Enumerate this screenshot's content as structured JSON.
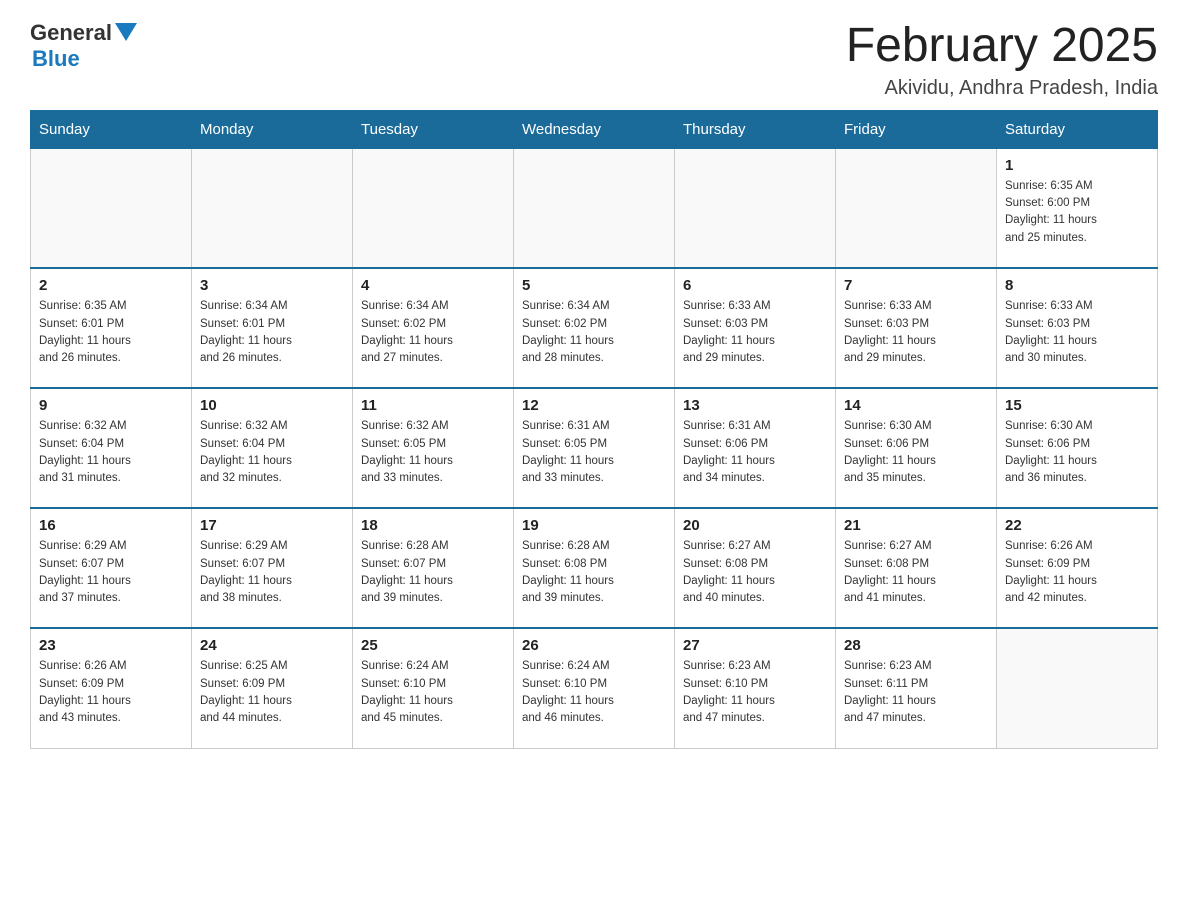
{
  "logo": {
    "line1": "General",
    "line2": "Blue"
  },
  "title": "February 2025",
  "subtitle": "Akividu, Andhra Pradesh, India",
  "days_of_week": [
    "Sunday",
    "Monday",
    "Tuesday",
    "Wednesday",
    "Thursday",
    "Friday",
    "Saturday"
  ],
  "weeks": [
    [
      {
        "day": "",
        "info": ""
      },
      {
        "day": "",
        "info": ""
      },
      {
        "day": "",
        "info": ""
      },
      {
        "day": "",
        "info": ""
      },
      {
        "day": "",
        "info": ""
      },
      {
        "day": "",
        "info": ""
      },
      {
        "day": "1",
        "info": "Sunrise: 6:35 AM\nSunset: 6:00 PM\nDaylight: 11 hours\nand 25 minutes."
      }
    ],
    [
      {
        "day": "2",
        "info": "Sunrise: 6:35 AM\nSunset: 6:01 PM\nDaylight: 11 hours\nand 26 minutes."
      },
      {
        "day": "3",
        "info": "Sunrise: 6:34 AM\nSunset: 6:01 PM\nDaylight: 11 hours\nand 26 minutes."
      },
      {
        "day": "4",
        "info": "Sunrise: 6:34 AM\nSunset: 6:02 PM\nDaylight: 11 hours\nand 27 minutes."
      },
      {
        "day": "5",
        "info": "Sunrise: 6:34 AM\nSunset: 6:02 PM\nDaylight: 11 hours\nand 28 minutes."
      },
      {
        "day": "6",
        "info": "Sunrise: 6:33 AM\nSunset: 6:03 PM\nDaylight: 11 hours\nand 29 minutes."
      },
      {
        "day": "7",
        "info": "Sunrise: 6:33 AM\nSunset: 6:03 PM\nDaylight: 11 hours\nand 29 minutes."
      },
      {
        "day": "8",
        "info": "Sunrise: 6:33 AM\nSunset: 6:03 PM\nDaylight: 11 hours\nand 30 minutes."
      }
    ],
    [
      {
        "day": "9",
        "info": "Sunrise: 6:32 AM\nSunset: 6:04 PM\nDaylight: 11 hours\nand 31 minutes."
      },
      {
        "day": "10",
        "info": "Sunrise: 6:32 AM\nSunset: 6:04 PM\nDaylight: 11 hours\nand 32 minutes."
      },
      {
        "day": "11",
        "info": "Sunrise: 6:32 AM\nSunset: 6:05 PM\nDaylight: 11 hours\nand 33 minutes."
      },
      {
        "day": "12",
        "info": "Sunrise: 6:31 AM\nSunset: 6:05 PM\nDaylight: 11 hours\nand 33 minutes."
      },
      {
        "day": "13",
        "info": "Sunrise: 6:31 AM\nSunset: 6:06 PM\nDaylight: 11 hours\nand 34 minutes."
      },
      {
        "day": "14",
        "info": "Sunrise: 6:30 AM\nSunset: 6:06 PM\nDaylight: 11 hours\nand 35 minutes."
      },
      {
        "day": "15",
        "info": "Sunrise: 6:30 AM\nSunset: 6:06 PM\nDaylight: 11 hours\nand 36 minutes."
      }
    ],
    [
      {
        "day": "16",
        "info": "Sunrise: 6:29 AM\nSunset: 6:07 PM\nDaylight: 11 hours\nand 37 minutes."
      },
      {
        "day": "17",
        "info": "Sunrise: 6:29 AM\nSunset: 6:07 PM\nDaylight: 11 hours\nand 38 minutes."
      },
      {
        "day": "18",
        "info": "Sunrise: 6:28 AM\nSunset: 6:07 PM\nDaylight: 11 hours\nand 39 minutes."
      },
      {
        "day": "19",
        "info": "Sunrise: 6:28 AM\nSunset: 6:08 PM\nDaylight: 11 hours\nand 39 minutes."
      },
      {
        "day": "20",
        "info": "Sunrise: 6:27 AM\nSunset: 6:08 PM\nDaylight: 11 hours\nand 40 minutes."
      },
      {
        "day": "21",
        "info": "Sunrise: 6:27 AM\nSunset: 6:08 PM\nDaylight: 11 hours\nand 41 minutes."
      },
      {
        "day": "22",
        "info": "Sunrise: 6:26 AM\nSunset: 6:09 PM\nDaylight: 11 hours\nand 42 minutes."
      }
    ],
    [
      {
        "day": "23",
        "info": "Sunrise: 6:26 AM\nSunset: 6:09 PM\nDaylight: 11 hours\nand 43 minutes."
      },
      {
        "day": "24",
        "info": "Sunrise: 6:25 AM\nSunset: 6:09 PM\nDaylight: 11 hours\nand 44 minutes."
      },
      {
        "day": "25",
        "info": "Sunrise: 6:24 AM\nSunset: 6:10 PM\nDaylight: 11 hours\nand 45 minutes."
      },
      {
        "day": "26",
        "info": "Sunrise: 6:24 AM\nSunset: 6:10 PM\nDaylight: 11 hours\nand 46 minutes."
      },
      {
        "day": "27",
        "info": "Sunrise: 6:23 AM\nSunset: 6:10 PM\nDaylight: 11 hours\nand 47 minutes."
      },
      {
        "day": "28",
        "info": "Sunrise: 6:23 AM\nSunset: 6:11 PM\nDaylight: 11 hours\nand 47 minutes."
      },
      {
        "day": "",
        "info": ""
      }
    ]
  ]
}
